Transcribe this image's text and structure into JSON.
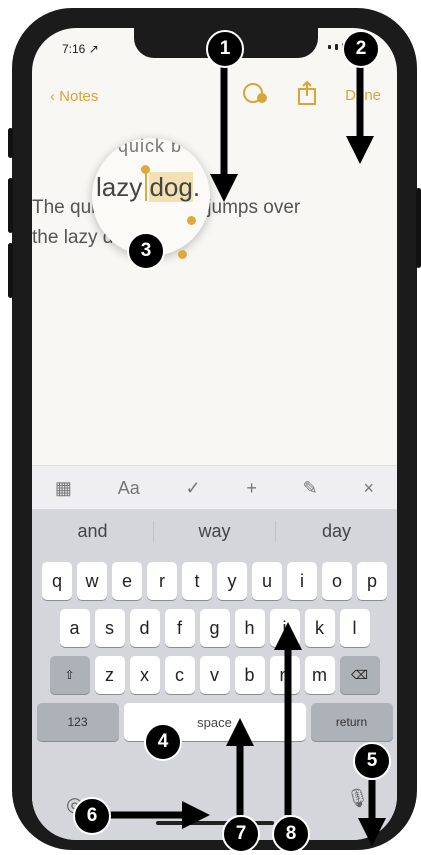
{
  "status": {
    "time": "7:16 ↗"
  },
  "nav": {
    "back_label": "Notes",
    "done_label": "Done"
  },
  "note": {
    "line1": "The quick brown fox jumps over",
    "line2": "the lazy dog."
  },
  "magnifier": {
    "top_text": "quick b",
    "main_text_pre": "lazy ",
    "main_text_sel": "dog",
    "main_text_post": "."
  },
  "toolbar": {
    "table": "▦",
    "format": "Aa",
    "check": "✓",
    "plus": "+",
    "draw": "✎",
    "close": "×"
  },
  "suggestions": [
    "and",
    "way",
    "day"
  ],
  "keyboard": {
    "row1": [
      "q",
      "w",
      "e",
      "r",
      "t",
      "y",
      "u",
      "i",
      "o",
      "p"
    ],
    "row2": [
      "a",
      "s",
      "d",
      "f",
      "g",
      "h",
      "j",
      "k",
      "l"
    ],
    "row3": [
      "z",
      "x",
      "c",
      "v",
      "b",
      "n",
      "m"
    ],
    "numbers_label": "123",
    "space_label": "space",
    "return_label": "return"
  },
  "callouts": [
    "1",
    "2",
    "3",
    "4",
    "5",
    "6",
    "7",
    "8"
  ],
  "colors": {
    "accent": "#d9a43a",
    "keyboard_bg": "#d4d6db",
    "frame": "#1b1b1b"
  }
}
